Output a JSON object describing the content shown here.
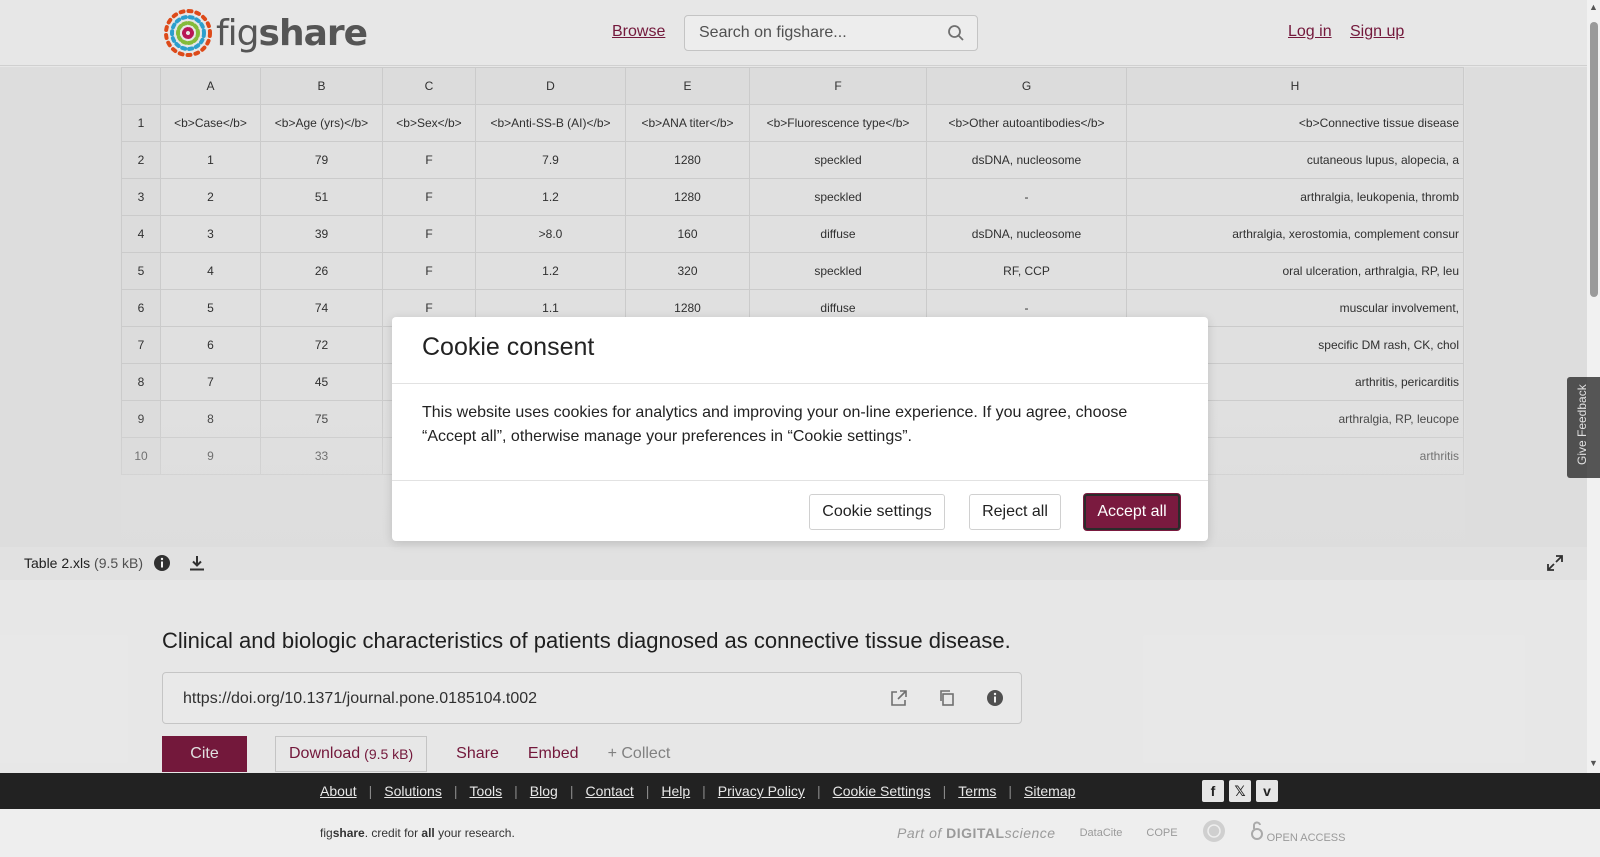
{
  "header": {
    "logo_text_light": "fig",
    "logo_text_bold": "share",
    "browse": "Browse",
    "search_placeholder": "Search on figshare...",
    "login": "Log in",
    "signup": "Sign up"
  },
  "sheet": {
    "columns": [
      "A",
      "B",
      "C",
      "D",
      "E",
      "F",
      "G",
      "H"
    ],
    "rows": [
      {
        "n": "1",
        "cells": [
          "<b>Case</b>",
          "<b>Age (yrs)</b>",
          "<b>Sex</b>",
          "<b>Anti-SS-B (AI)</b>",
          "<b>ANA titer</b>",
          "<b>Fluorescence type</b>",
          "<b>Other autoantibodies</b>",
          "<b>Connective tissue disease"
        ]
      },
      {
        "n": "2",
        "cells": [
          "1",
          "79",
          "F",
          "7.9",
          "1280",
          "speckled",
          "dsDNA, nucleosome",
          "cutaneous lupus, alopecia, a"
        ]
      },
      {
        "n": "3",
        "cells": [
          "2",
          "51",
          "F",
          "1.2",
          "1280",
          "speckled",
          "-",
          "arthralgia, leukopenia, thromb"
        ]
      },
      {
        "n": "4",
        "cells": [
          "3",
          "39",
          "F",
          ">8.0",
          "160",
          "diffuse",
          "dsDNA, nucleosome",
          "arthralgia, xerostomia, complement consur"
        ]
      },
      {
        "n": "5",
        "cells": [
          "4",
          "26",
          "F",
          "1.2",
          "320",
          "speckled",
          "RF, CCP",
          "oral ulceration, arthralgia, RP, leu"
        ]
      },
      {
        "n": "6",
        "cells": [
          "5",
          "74",
          "F",
          "1.1",
          "1280",
          "diffuse",
          "-",
          "muscular involvement,"
        ]
      },
      {
        "n": "7",
        "cells": [
          "6",
          "72",
          "",
          "",
          "",
          "",
          "",
          "specific DM rash, CK, chol"
        ]
      },
      {
        "n": "8",
        "cells": [
          "7",
          "45",
          "",
          "",
          "",
          "",
          "",
          "arthritis, pericarditis"
        ]
      },
      {
        "n": "9",
        "cells": [
          "8",
          "75",
          "",
          "",
          "",
          "",
          "",
          "arthralgia, RP, leucope"
        ]
      },
      {
        "n": "10",
        "cells": [
          "9",
          "33",
          "",
          "",
          "",
          "",
          "",
          "arthritis"
        ]
      }
    ]
  },
  "filebar": {
    "filename": "Table 2.xls",
    "size": "(9.5 kB)"
  },
  "item": {
    "title": "Clinical and biologic characteristics of patients diagnosed as connective tissue disease.",
    "doi": "https://doi.org/10.1371/journal.pone.0185104.t002"
  },
  "actions": {
    "cite": "Cite",
    "download": "Download",
    "download_size": "(9.5 kB)",
    "share": "Share",
    "embed": "Embed",
    "collect": "+ Collect"
  },
  "feedback": "Give Feedback",
  "footer": {
    "links": [
      "About",
      "Solutions",
      "Tools",
      "Blog",
      "Contact",
      "Help",
      "Privacy Policy",
      "Cookie Settings",
      "Terms",
      "Sitemap"
    ],
    "tagline_fig": "fig",
    "tagline_share": "share",
    "tagline_mid": ". credit for ",
    "tagline_all": "all",
    "tagline_end": " your research.",
    "partner_part_of": "Part of",
    "partner_digital": "DIGITAL",
    "partner_science": "science",
    "partner_datacite": "DataCite",
    "partner_cope": "COPE",
    "partner_oa": "OPEN ACCESS"
  },
  "cookie": {
    "title": "Cookie consent",
    "body": "This website uses cookies for analytics and improving your on-line experience. If you agree, choose “Accept all”, otherwise manage your preferences in “Cookie settings”.",
    "settings": "Cookie settings",
    "reject": "Reject all",
    "accept": "Accept all"
  },
  "colors": {
    "brand": "#7a1a3f",
    "footer_bg": "#222222"
  }
}
